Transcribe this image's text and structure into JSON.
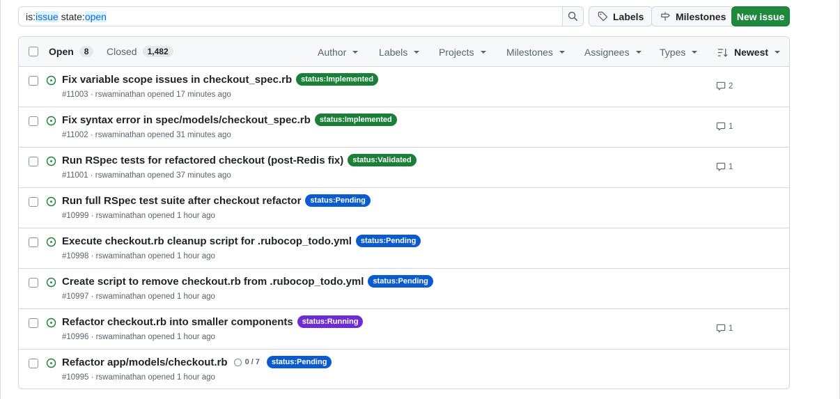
{
  "search": {
    "qualifier1": "is:",
    "value1": "issue",
    "qualifier2": " state:",
    "value2": "open",
    "icon": "search-icon"
  },
  "toolbar": {
    "labels_label": "Labels",
    "milestones_label": "Milestones",
    "new_issue_label": "New issue"
  },
  "header": {
    "open_label": "Open",
    "open_count": "8",
    "closed_label": "Closed",
    "closed_count": "1,482",
    "filters": [
      "Author",
      "Labels",
      "Projects",
      "Milestones",
      "Assignees",
      "Types"
    ],
    "sort_label": "Newest"
  },
  "colors": {
    "implemented": "#1a7f37",
    "validated": "#1a7f37",
    "pending": "#0a5bd0",
    "running": "#6e2cd6"
  },
  "issues": [
    {
      "title": "Fix variable scope issues in checkout_spec.rb",
      "label": "status:Implemented",
      "meta": "#11003 · rswaminathan opened 17 minutes ago",
      "comments": "2"
    },
    {
      "title": "Fix syntax error in spec/models/checkout_spec.rb",
      "label": "status:Implemented",
      "meta": "#11002 · rswaminathan opened 31 minutes ago",
      "comments": "1"
    },
    {
      "title": "Run RSpec tests for refactored checkout (post-Redis fix)",
      "label": "status:Validated",
      "meta": "#11001 · rswaminathan opened 37 minutes ago",
      "comments": "1"
    },
    {
      "title": "Run full RSpec test suite after checkout refactor",
      "label": "status:Pending",
      "meta": "#10999 · rswaminathan opened 1 hour ago",
      "comments": ""
    },
    {
      "title": "Execute checkout.rb cleanup script for .rubocop_todo.yml",
      "label": "status:Pending",
      "meta": "#10998 · rswaminathan opened 1 hour ago",
      "comments": ""
    },
    {
      "title": "Create script to remove checkout.rb from .rubocop_todo.yml",
      "label": "status:Pending",
      "meta": "#10997 · rswaminathan opened 1 hour ago",
      "comments": ""
    },
    {
      "title": "Refactor checkout.rb into smaller components",
      "label": "status:Running",
      "meta": "#10996 · rswaminathan opened 1 hour ago",
      "comments": "1"
    },
    {
      "title": "Refactor app/models/checkout.rb",
      "label": "status:Pending",
      "meta": "#10995 · rswaminathan opened 1 hour ago",
      "comments": "",
      "tasks": "0 / 7"
    }
  ]
}
